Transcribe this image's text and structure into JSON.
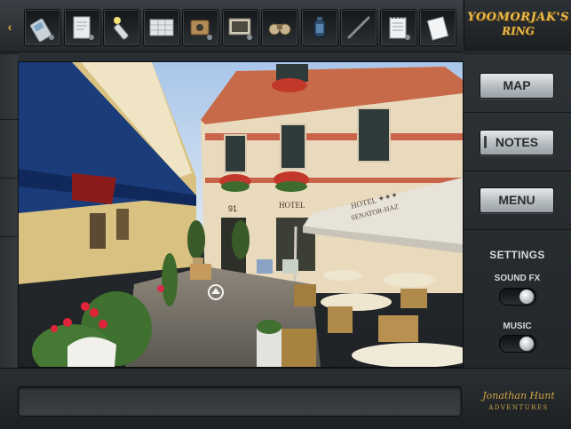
{
  "inventory": {
    "left_arrow": "‹",
    "right_arrow": "›",
    "items": [
      {
        "name": "cell-phone-icon"
      },
      {
        "name": "document-icon"
      },
      {
        "name": "flashlight-icon"
      },
      {
        "name": "map-sheet-icon"
      },
      {
        "name": "device-icon"
      },
      {
        "name": "photo-icon"
      },
      {
        "name": "binoculars-icon"
      },
      {
        "name": "lantern-icon"
      },
      {
        "name": "rod-icon"
      },
      {
        "name": "notepad-icon"
      },
      {
        "name": "paper-icon"
      }
    ]
  },
  "logo": {
    "line1": "YOOMORJAK'S",
    "line2": "RING"
  },
  "nav": {
    "map_label": "MAP",
    "notes_label": "NOTES",
    "menu_label": "MENU"
  },
  "settings": {
    "title": "SETTINGS",
    "sound_fx_label": "SOUND FX",
    "music_label": "MUSIC",
    "sound_fx_on": true,
    "music_on": true
  },
  "scene": {
    "hotel_sign": "HOTEL",
    "umbrella_sign_1": "HOTEL ✦✦✦",
    "umbrella_sign_2": "SENATOR-HAZ",
    "door_number": "91"
  },
  "message": {
    "text": ""
  },
  "brand": {
    "line1": "Jonathan Hunt",
    "line2": "ADVENTURES"
  }
}
